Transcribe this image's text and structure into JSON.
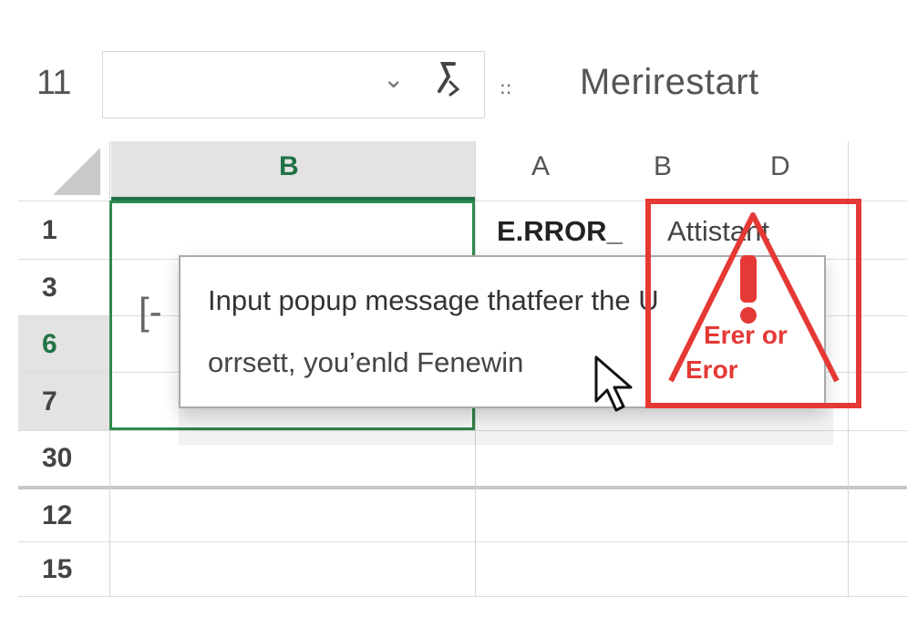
{
  "formula_bar": {
    "cell_ref": "11",
    "dropdown_glyph": "⌄",
    "separator_glyph": "::",
    "content": "Merirestart"
  },
  "columns": {
    "selected": "B",
    "others": [
      "A",
      "B",
      "D"
    ]
  },
  "rows": [
    "1",
    "3",
    "6",
    "7",
    "30",
    "12",
    "15"
  ],
  "selected_rows": [
    "6"
  ],
  "cells": {
    "a1": "E.RROR_",
    "b1": "Attistant",
    "bracket": "[-"
  },
  "popup": {
    "line1": "Input popup message thatfeer the U",
    "line2": "orrsett, you’enld Fenewin"
  },
  "error_marker": {
    "line1": "Erer or",
    "line2": "Eror",
    "color": "#e53935"
  },
  "colors": {
    "selection_green": "#217346",
    "header_gray": "#e3e3e3"
  }
}
